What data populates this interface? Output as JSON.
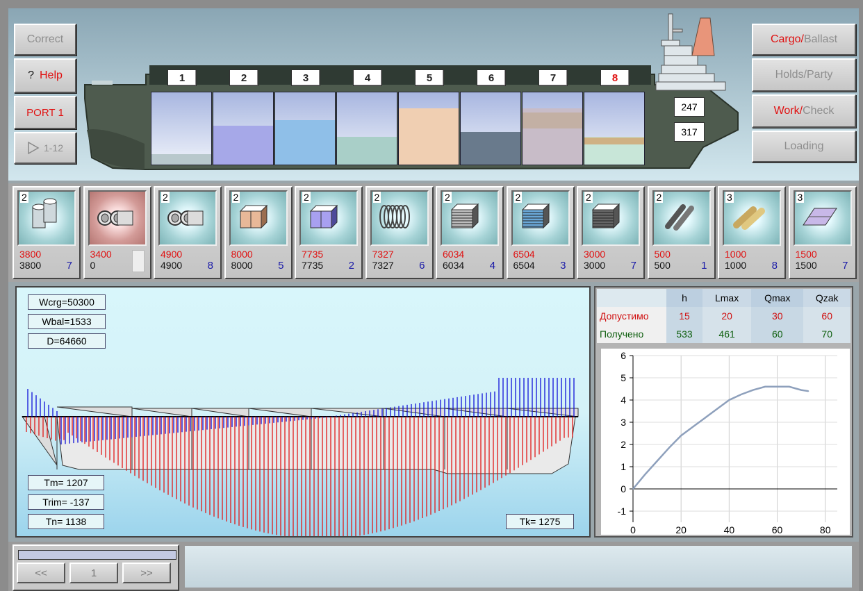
{
  "left_buttons": {
    "correct": "Correct",
    "help_mark": "?",
    "help": "Help",
    "port": "PORT 1",
    "play_icon": "play-triangle-icon",
    "range": "1-12"
  },
  "right_buttons": {
    "cargo": "Cargo/",
    "ballast": "Ballast",
    "holds": "Holds/Party",
    "work": "Work/",
    "check": "Check",
    "loading": "Loading"
  },
  "holds": [
    {
      "num": "1",
      "fill": 0.14,
      "color": "#b8c8cc"
    },
    {
      "num": "2",
      "fill": 0.54,
      "color": "#a6a8e8"
    },
    {
      "num": "3",
      "fill": 0.62,
      "color": "#8fbfe8"
    },
    {
      "num": "4",
      "fill": 0.38,
      "color": "#a9cfc8"
    },
    {
      "num": "5",
      "fill": 0.78,
      "color": "#f0cfb2"
    },
    {
      "num": "6",
      "fill": 0.45,
      "color": "#697a8c"
    },
    {
      "num": "7",
      "fill": 0.78,
      "color": "#c8bcc8"
    },
    {
      "num": "8",
      "fill": 0.38,
      "color": "#c8e6d8",
      "selected": true
    }
  ],
  "drafts": {
    "upper": "247",
    "lower": "317"
  },
  "cargos": [
    {
      "count": "2",
      "plan": "3800",
      "fact": "3800",
      "hold": "7",
      "icon": "pipe-rolls-icon"
    },
    {
      "count": "",
      "plan": "3400",
      "fact": "0",
      "hold": "",
      "icon": "pipes-icon",
      "selected": true
    },
    {
      "count": "2",
      "plan": "4900",
      "fact": "4900",
      "hold": "8",
      "icon": "pipes-icon"
    },
    {
      "count": "2",
      "plan": "8000",
      "fact": "8000",
      "hold": "5",
      "icon": "boxes-tan-icon"
    },
    {
      "count": "2",
      "plan": "7735",
      "fact": "7735",
      "hold": "2",
      "icon": "boxes-violet-icon"
    },
    {
      "count": "2",
      "plan": "7327",
      "fact": "7327",
      "hold": "6",
      "icon": "coils-icon"
    },
    {
      "count": "2",
      "plan": "6034",
      "fact": "6034",
      "hold": "4",
      "icon": "sheet-packs-grey-icon"
    },
    {
      "count": "2",
      "plan": "6504",
      "fact": "6504",
      "hold": "3",
      "icon": "sheet-packs-blue-icon"
    },
    {
      "count": "2",
      "plan": "3000",
      "fact": "3000",
      "hold": "7",
      "icon": "sheet-packs-dark-icon"
    },
    {
      "count": "2",
      "plan": "500",
      "fact": "500",
      "hold": "1",
      "icon": "steel-bars-icon"
    },
    {
      "count": "3",
      "plan": "1000",
      "fact": "1000",
      "hold": "8",
      "icon": "wood-logs-icon"
    },
    {
      "count": "3",
      "plan": "1500",
      "fact": "1500",
      "hold": "7",
      "icon": "steel-plate-icon"
    }
  ],
  "bending": {
    "wcrg": "Wcrg=50300",
    "wbal": "Wbal=1533",
    "d": "D=64660",
    "tm": "Tm= 1207",
    "trim": "Trim= -137",
    "tn": "Tn= 1138",
    "tk": "Tk= 1275",
    "colors": {
      "shear": "#1010d8",
      "moment": "#e01818"
    }
  },
  "stress_table": {
    "headers": [
      "",
      "h",
      "Lmax",
      "Qmax",
      "Qzak"
    ],
    "rows": [
      {
        "label": "Допустимо",
        "color": "#d01010",
        "values": [
          "15",
          "20",
          "30",
          "60"
        ]
      },
      {
        "label": "Получено",
        "color": "#106010",
        "values": [
          "533",
          "461",
          "60",
          "70"
        ]
      }
    ]
  },
  "chart_data": {
    "type": "line",
    "x": [
      0,
      5,
      10,
      15,
      20,
      25,
      30,
      35,
      40,
      45,
      50,
      55,
      60,
      65,
      70,
      73
    ],
    "y": [
      0,
      0.65,
      1.25,
      1.85,
      2.4,
      2.8,
      3.2,
      3.6,
      4.0,
      4.25,
      4.45,
      4.6,
      4.6,
      4.6,
      4.45,
      4.4
    ],
    "xlim": [
      0,
      85
    ],
    "ylim": [
      -1.5,
      6
    ],
    "xticks": [
      "0",
      "20",
      "40",
      "60",
      "80"
    ],
    "yticks": [
      "6",
      "5",
      "4",
      "3",
      "2",
      "1",
      "0",
      "-1"
    ],
    "grid": true
  },
  "nav": {
    "prev": "<<",
    "page": "1",
    "next": ">>"
  }
}
